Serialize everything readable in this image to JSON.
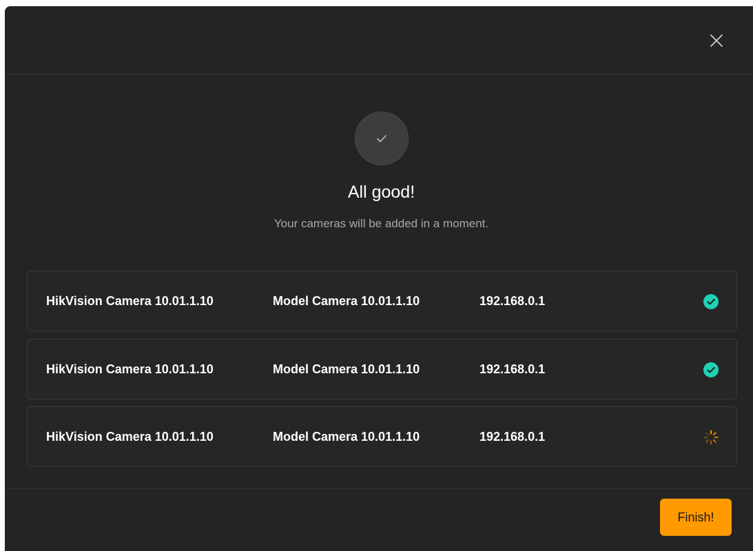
{
  "dialog": {
    "close_icon": "close-icon",
    "status_icon": "checkmark-icon",
    "title": "All good!",
    "subtitle": "Your cameras will be added in a moment."
  },
  "cameras": [
    {
      "name": "HikVision Camera 10.01.1.10",
      "model": "Model Camera 10.01.1.10",
      "ip": "192.168.0.1",
      "status": "done",
      "status_icon": "check-circle-icon"
    },
    {
      "name": "HikVision Camera 10.01.1.10",
      "model": "Model Camera 10.01.1.10",
      "ip": "192.168.0.1",
      "status": "done",
      "status_icon": "check-circle-icon"
    },
    {
      "name": "HikVision Camera 10.01.1.10",
      "model": "Model Camera 10.01.1.10",
      "ip": "192.168.0.1",
      "status": "loading",
      "status_icon": "spinner-icon"
    }
  ],
  "footer": {
    "finish_label": "Finish!"
  },
  "colors": {
    "success": "#1fd1b5",
    "accent": "#ff9a00",
    "background": "#242424"
  }
}
